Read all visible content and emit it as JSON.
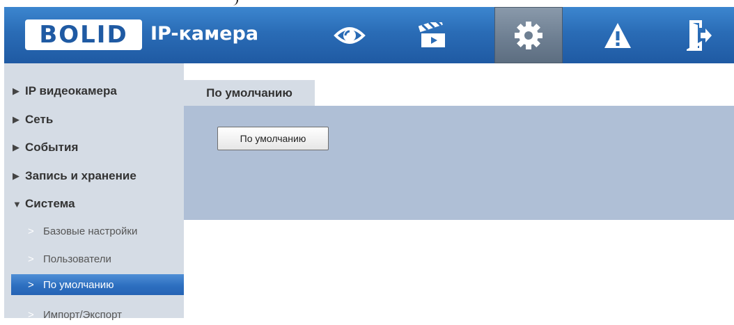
{
  "header": {
    "logo_text": "BOLID",
    "title": "IP-камера",
    "nav": [
      {
        "icon": "eye-icon",
        "active": false
      },
      {
        "icon": "clapperboard-icon",
        "active": false
      },
      {
        "icon": "gear-icon",
        "active": true
      },
      {
        "icon": "warning-icon",
        "active": false
      },
      {
        "icon": "logout-icon",
        "active": false
      }
    ]
  },
  "sidebar": {
    "items": [
      {
        "label": "IP видеокамера",
        "expanded": false
      },
      {
        "label": "Сеть",
        "expanded": false
      },
      {
        "label": "События",
        "expanded": false
      },
      {
        "label": "Запись и хранение",
        "expanded": false
      },
      {
        "label": "Система",
        "expanded": true
      }
    ],
    "arrow_collapsed": "▶",
    "arrow_expanded": "▼",
    "sub_items": [
      {
        "label": "Базовые настройки"
      },
      {
        "label": "Пользователи"
      },
      {
        "label": "По умолчанию",
        "active": true
      },
      {
        "label": "Импорт/Экспорт"
      }
    ],
    "chevron": ">"
  },
  "content": {
    "tab_label": "По умолчанию",
    "button_label": "По умолчанию"
  },
  "colors": {
    "header": "#2a6cb6",
    "sidebar": "#d5dce5",
    "panel": "#afbfd6",
    "active_item": "#2d6fc0"
  }
}
